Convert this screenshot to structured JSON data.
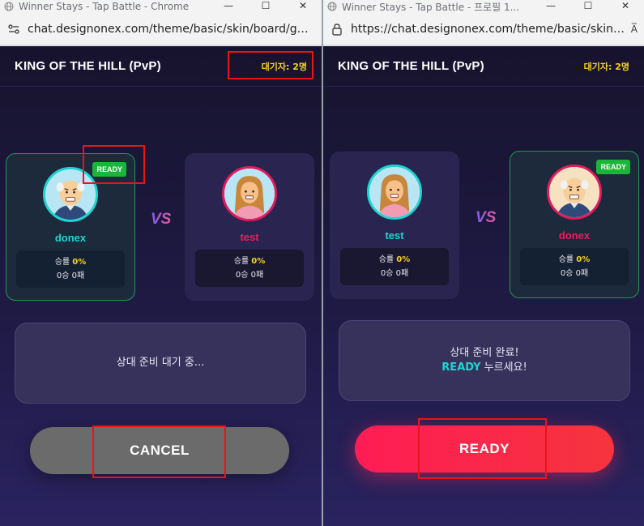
{
  "left_window": {
    "tab_title": "Winner Stays - Tap Battle - Chrome",
    "url": "chat.designonex.com/theme/basic/skin/board/game...",
    "controls": [
      "—",
      "☐",
      "✕"
    ]
  },
  "right_window": {
    "tab_title": "Winner Stays - Tap Battle - 프로필 1...",
    "url": "https://chat.designonex.com/theme/basic/skin/boar...",
    "controls": [
      "—",
      "☐",
      "✕"
    ],
    "reader": "A̅"
  },
  "game": {
    "title": "KING OF THE HILL (PvP)",
    "waiting_label": "대기자: 2명",
    "vs": "VS",
    "ready_badge": "READY",
    "rate_label": "승률",
    "rate_value": "0%",
    "record": "0승 0패"
  },
  "left_panel": {
    "p1_name": "donex",
    "p2_name": "test",
    "message": "상대 준비 대기 중...",
    "button": "CANCEL"
  },
  "right_panel": {
    "p1_name": "test",
    "p2_name": "donex",
    "message_line1": "상대 준비 완료!",
    "message_hl": "READY",
    "message_rest": " 누르세요!",
    "button": "READY"
  },
  "colors": {
    "accent_cyan": "#1fd4d0",
    "accent_pink": "#ef1b5f",
    "gold": "#f7d21e",
    "ready_green": "#1db43a",
    "highlight_red": "#e8141a"
  }
}
